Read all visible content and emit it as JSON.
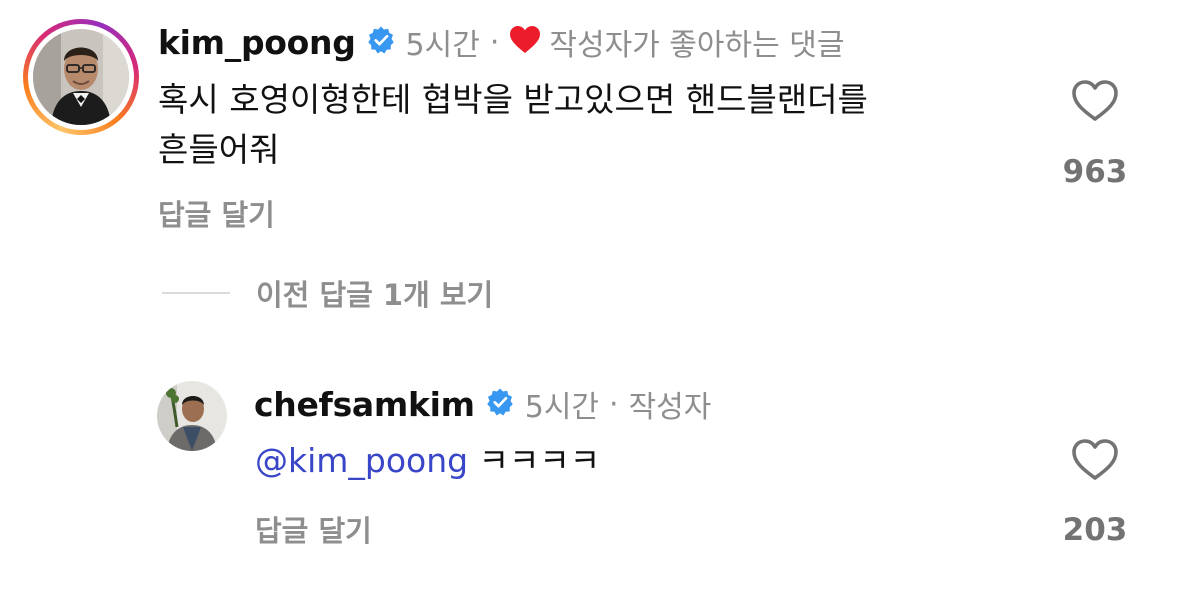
{
  "comments": [
    {
      "username": "kim_poong",
      "verified": true,
      "time": "5시간",
      "creator_liked_label": "작성자가 좋아하는 댓글",
      "text_line1": "혹시 호영이형한테 협박을 받고있으면 핸드블랜더를",
      "text_line2": "흔들어줘",
      "reply_label": "답글 달기",
      "like_count": "963"
    },
    {
      "username": "chefsamkim",
      "verified": true,
      "time": "5시간",
      "author_label": "작성자",
      "mention": "@kim_poong",
      "text": "ㅋㅋㅋㅋ",
      "reply_label": "답글 달기",
      "like_count": "203"
    }
  ],
  "view_previous_replies": "이전 답글 1개 보기",
  "colors": {
    "verified_blue": "#3897f0",
    "creator_heart": "#ed1c2a",
    "mention_blue": "#3946c7",
    "secondary_text": "#8e8e8e"
  },
  "icons": [
    "verified-badge-icon",
    "heart-filled-icon",
    "heart-outline-icon"
  ]
}
